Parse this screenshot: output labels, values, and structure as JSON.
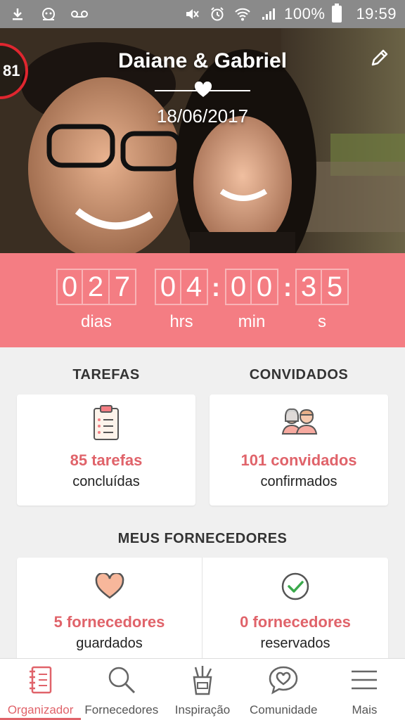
{
  "status_bar": {
    "battery": "100%",
    "time": "19:59",
    "icons": [
      "download-icon",
      "app-notification-icon",
      "voicemail-icon",
      "mute-icon",
      "alarm-icon",
      "wifi-icon",
      "signal-icon",
      "battery-icon"
    ]
  },
  "header": {
    "couple_name": "Daiane & Gabriel",
    "wedding_date": "18/06/2017",
    "progress_value": "81",
    "icons": {
      "edit": "pencil-icon",
      "divider": "heart-icon"
    }
  },
  "countdown": {
    "days": [
      "0",
      "2",
      "7"
    ],
    "hours": [
      "0",
      "4"
    ],
    "minutes": [
      "0",
      "0"
    ],
    "seconds": [
      "3",
      "5"
    ],
    "labels": {
      "days": "dias",
      "hours": "hrs",
      "minutes": "min",
      "seconds": "s"
    }
  },
  "tasks": {
    "title": "TAREFAS",
    "count_text": "85 tarefas",
    "sub_text": "concluídas",
    "icon": "clipboard-checklist-icon"
  },
  "guests": {
    "title": "CONVIDADOS",
    "count_text": "101 convidados",
    "sub_text": "confirmados",
    "icon": "guests-couple-icon"
  },
  "vendors": {
    "title": "MEUS FORNECEDORES",
    "saved": {
      "count_text": "5 fornecedores",
      "sub_text": "guardados",
      "icon": "heart-outline-icon"
    },
    "booked": {
      "count_text": "0 fornecedores",
      "sub_text": "reservados",
      "icon": "check-circle-icon"
    }
  },
  "bottom_nav": {
    "items": [
      {
        "label": "Organizador",
        "icon": "notebook-icon",
        "active": true
      },
      {
        "label": "Fornecedores",
        "icon": "search-icon",
        "active": false
      },
      {
        "label": "Inspiração",
        "icon": "brushes-cup-icon",
        "active": false
      },
      {
        "label": "Comunidade",
        "icon": "chat-heart-icon",
        "active": false
      },
      {
        "label": "Mais",
        "icon": "menu-icon",
        "active": false
      }
    ]
  },
  "colors": {
    "accent": "#f47d83",
    "accent_text": "#e0636a",
    "status_bar": "#8a8a8a"
  }
}
